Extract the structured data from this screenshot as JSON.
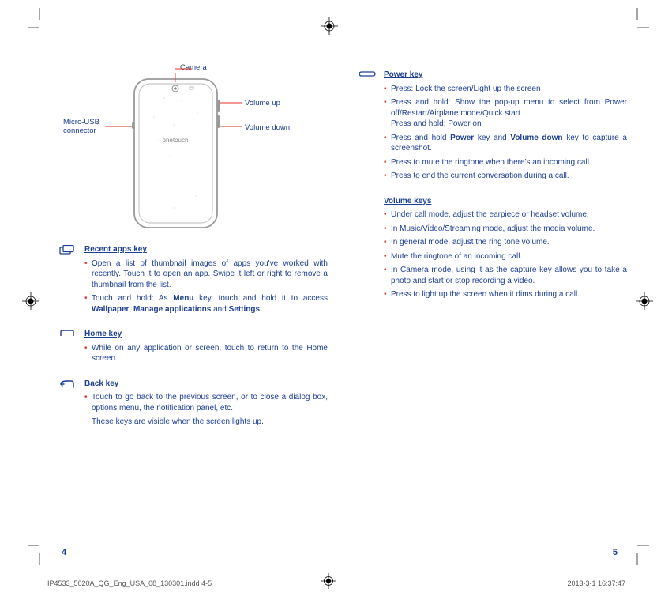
{
  "diagram": {
    "camera": "Camera",
    "volume_up": "Volume up",
    "volume_down": "Volume down",
    "micro_usb": "Micro-USB connector",
    "brand": "onetouch"
  },
  "left": {
    "recent_title": "Recent apps key",
    "recent_items": [
      "Open a list of thumbnail images of apps you've worked with recently. Touch it to open an app. Swipe it left or right to remove a thumbnail from the list.",
      "Touch and hold: As <b>Menu</b> key, touch and hold it to access <b>Wallpaper</b>, <b>Manage applications</b> and <b>Settings</b>."
    ],
    "home_title": "Home key",
    "home_items": [
      "While on any application or screen,  touch to return to the Home screen."
    ],
    "back_title": "Back key",
    "back_items": [
      "Touch to go back to the previous screen, or to close a dialog box, options menu, the notification panel, etc."
    ],
    "back_para": "These keys are visible when the screen lights up."
  },
  "right": {
    "power_title": "Power key",
    "power_items": [
      "Press: Lock the screen/Light up the screen",
      "Press and hold: Show the pop-up menu to select from Power off/Restart/Airplane mode/Quick start<br>Press and hold: Power on",
      "Press and hold <b>Power</b> key and <b>Volume down</b> key to capture a screenshot.",
      "Press to mute the ringtone when there's an incoming call.",
      "Press to end the current conversation during a call."
    ],
    "volume_title": "Volume keys",
    "volume_items": [
      "Under call mode, adjust the earpiece or headset volume.",
      "In Music/Video/Streaming mode, adjust the media volume.",
      "In general mode, adjust the ring tone volume.",
      "Mute the ringtone of an incoming call.",
      "In Camera mode, using it as the capture key allows you to take a photo and start or stop recording a video.",
      "Press to light up the screen when it dims during a call."
    ]
  },
  "page_left": "4",
  "page_right": "5",
  "footer": {
    "file": "IP4533_5020A_QG_Eng_USA_08_130301.indd   4-5",
    "datetime": "2013-3-1   16:37:47"
  }
}
